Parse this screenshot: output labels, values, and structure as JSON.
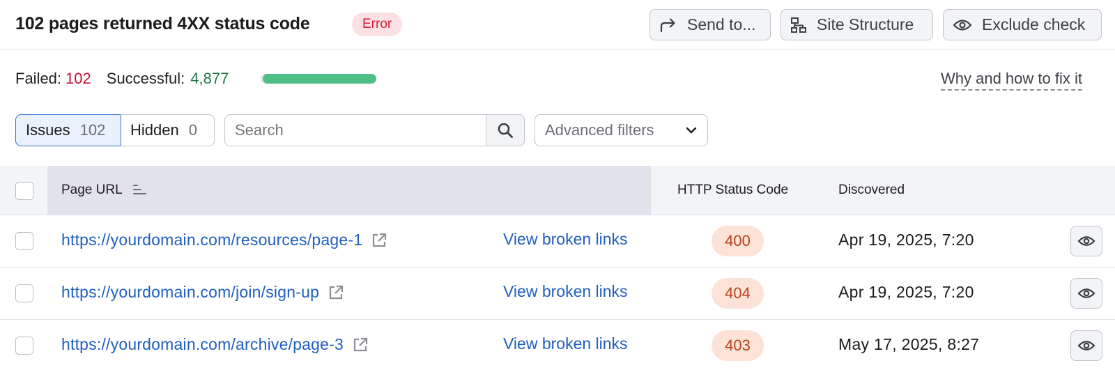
{
  "header": {
    "title": "102 pages returned 4XX status code",
    "badge": "Error",
    "buttons": {
      "send": "Send to...",
      "site_structure": "Site Structure",
      "exclude": "Exclude check"
    }
  },
  "stats": {
    "failed_label": "Failed:",
    "failed_value": "102",
    "successful_label": "Successful:",
    "successful_value": "4,877",
    "success_fraction": 0.98,
    "fix_link": "Why and how to fix it"
  },
  "filters": {
    "issues_label": "Issues",
    "issues_count": "102",
    "hidden_label": "Hidden",
    "hidden_count": "0",
    "search_placeholder": "Search",
    "advanced": "Advanced filters"
  },
  "table": {
    "columns": {
      "url": "Page URL",
      "status": "HTTP Status Code",
      "discovered": "Discovered"
    },
    "rows": [
      {
        "url": "https://yourdomain.com/resources/page-1",
        "link": "View broken links",
        "code": "400",
        "date": "Apr 19, 2025, 7:20"
      },
      {
        "url": "https://yourdomain.com/join/sign-up",
        "link": "View broken links",
        "code": "404",
        "date": "Apr 19, 2025, 7:20"
      },
      {
        "url": "https://yourdomain.com/archive/page-3",
        "link": "View broken links",
        "code": "403",
        "date": "May 17, 2025, 8:27"
      }
    ]
  },
  "colors": {
    "accent_blue": "#1f5fbf",
    "error_red": "#c8102e",
    "success_green": "#1d7a46",
    "progress_green": "#4fbf86"
  },
  "icons": [
    "share-arrow-icon",
    "sitemap-icon",
    "eye-icon",
    "search-icon",
    "chevron-down-icon",
    "sort-icon",
    "external-link-icon"
  ]
}
